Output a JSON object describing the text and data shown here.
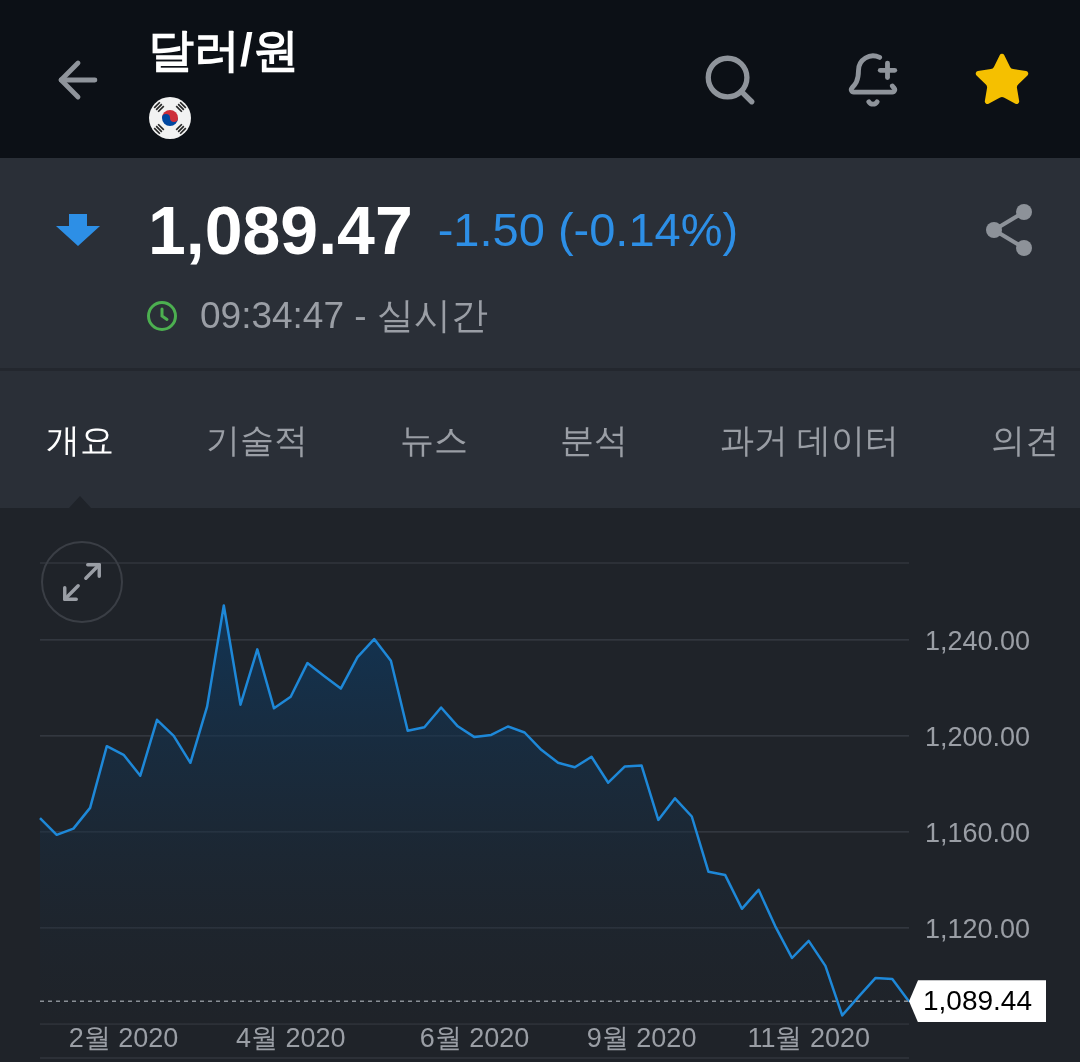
{
  "header": {
    "title": "달러/원",
    "favorite": true
  },
  "quote": {
    "falling": true,
    "price": "1,089.47",
    "change": "-1.50 (-0.14%)",
    "time": "09:34:47 - 실시간"
  },
  "tabs": [
    {
      "label": "개요",
      "selected": true
    },
    {
      "label": "기술적",
      "selected": false
    },
    {
      "label": "뉴스",
      "selected": false
    },
    {
      "label": "분석",
      "selected": false
    },
    {
      "label": "과거 데이터",
      "selected": false
    },
    {
      "label": "의견",
      "selected": false
    }
  ],
  "chart": {
    "chart_data": {
      "type": "area",
      "grid": true,
      "categories": [
        null,
        null,
        null,
        null,
        null,
        "2월 2020",
        null,
        null,
        null,
        null,
        null,
        null,
        null,
        null,
        null,
        "4월 2020",
        null,
        null,
        null,
        null,
        null,
        null,
        null,
        null,
        null,
        null,
        "6월 2020",
        null,
        null,
        null,
        null,
        null,
        null,
        null,
        null,
        null,
        "9월 2020",
        null,
        null,
        null,
        null,
        null,
        null,
        null,
        null,
        null,
        "11월 2020",
        null,
        null,
        null,
        null,
        null,
        null
      ],
      "values": [
        1165.7,
        1158.8,
        1161.4,
        1170.0,
        1195.7,
        1192.1,
        1183.4,
        1206.7,
        1200.0,
        1188.8,
        1212.2,
        1254.3,
        1213.0,
        1236.0,
        1211.5,
        1216.3,
        1230.3,
        1224.9,
        1219.7,
        1232.8,
        1240.3,
        1231.3,
        1202.1,
        1203.6,
        1211.8,
        1204.0,
        1199.5,
        1200.4,
        1203.9,
        1201.4,
        1194.2,
        1188.8,
        1186.9,
        1191.3,
        1180.5,
        1187.3,
        1187.6,
        1165.0,
        1174.0,
        1166.4,
        1143.4,
        1142.0,
        1128.0,
        1135.9,
        1120.7,
        1107.5,
        1114.6,
        1104.2,
        1083.6,
        1091.5,
        1099.2,
        1098.8,
        1089.4
      ],
      "ylim": [
        1080,
        1272
      ],
      "yticks": [
        {
          "value": 1120,
          "label": "1,120.00"
        },
        {
          "value": 1160,
          "label": "1,160.00"
        },
        {
          "value": 1200,
          "label": "1,200.00"
        },
        {
          "value": 1240,
          "label": "1,240.00"
        }
      ],
      "ref_lines": [
        {
          "axis": "y",
          "value": 1089.44,
          "label": "1,089.44"
        }
      ]
    }
  }
}
